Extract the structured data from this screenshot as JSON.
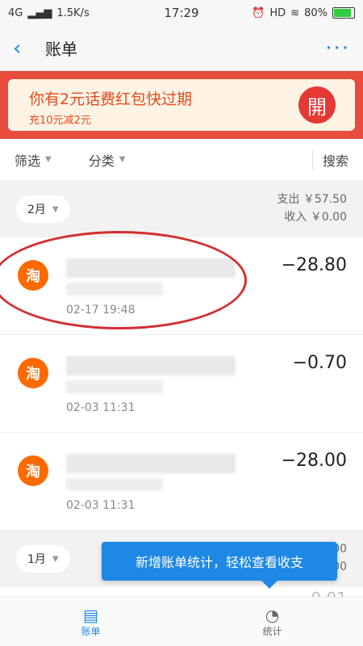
{
  "statusbar": {
    "network": "4G",
    "speed": "1.5K/s",
    "time": "17:29",
    "hd": "HD",
    "battery": "80%"
  },
  "header": {
    "title": "账单",
    "more": "···"
  },
  "banner": {
    "title": "你有2元话费红包快过期",
    "subtitle": "充10元减2元",
    "open_label": "開"
  },
  "filters": {
    "filter": "筛选",
    "category": "分类",
    "search": "搜索"
  },
  "months": [
    {
      "label": "2月",
      "expense": "支出 ￥57.50",
      "income": "收入 ￥0.00",
      "items": [
        {
          "time": "02-17  19:48",
          "amount": "−28.80",
          "icon_label": "淘"
        },
        {
          "time": "02-03  11:31",
          "amount": "−0.70",
          "icon_label": "淘"
        },
        {
          "time": "02-03  11:31",
          "amount": "−28.00",
          "icon_label": "淘"
        }
      ]
    },
    {
      "label": "1月",
      "expense": "支出 ￥0.00",
      "income": "收入 ￥0.00",
      "items": [
        {
          "amount": "0.01"
        }
      ]
    }
  ],
  "tooltip": {
    "text": "新增账单统计，轻松查看收支"
  },
  "tabs": [
    {
      "label": "账单",
      "icon": "bill-icon"
    },
    {
      "label": "统计",
      "icon": "pie-chart-icon"
    }
  ]
}
